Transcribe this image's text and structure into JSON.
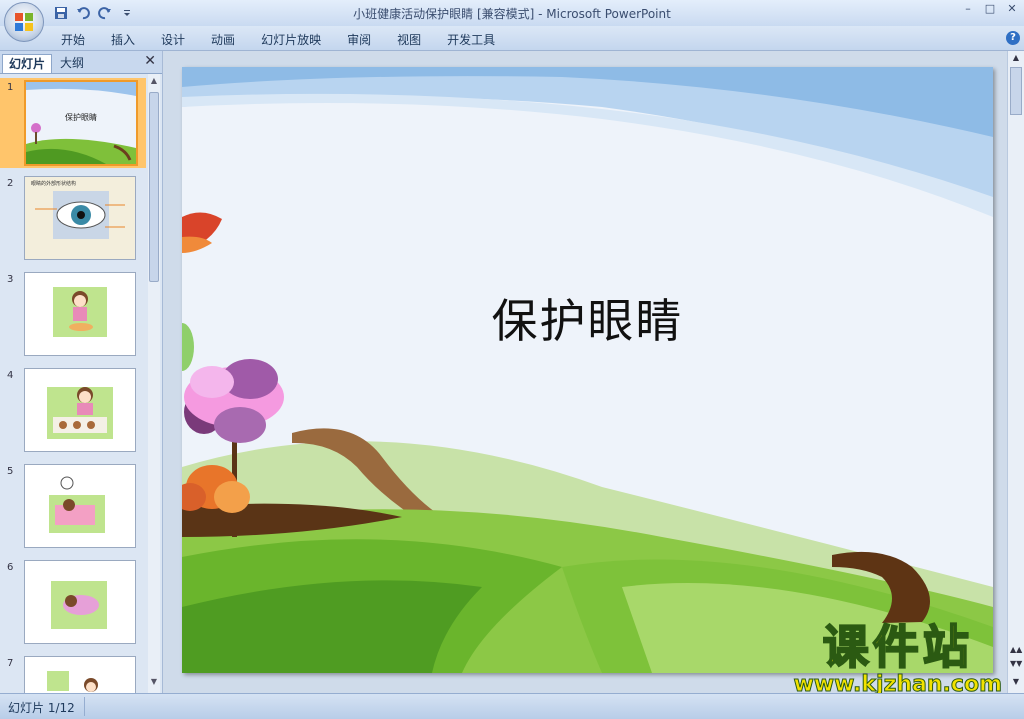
{
  "window": {
    "title": "小班健康活动保护眼睛 [兼容模式] - Microsoft PowerPoint",
    "controls": [
      "–",
      "□",
      "✕"
    ]
  },
  "qat": {
    "icons": [
      "save-icon",
      "undo-icon",
      "redo-icon",
      "customize-icon"
    ]
  },
  "menu": {
    "items": [
      "开始",
      "插入",
      "设计",
      "动画",
      "幻灯片放映",
      "审阅",
      "视图",
      "开发工具"
    ]
  },
  "panel": {
    "tabs": {
      "slides": "幻灯片",
      "outline": "大纲"
    },
    "thumbnails": [
      {
        "num": "1",
        "caption": "保护眼睛"
      },
      {
        "num": "2",
        "caption": "眼睛的外部形状结构"
      },
      {
        "num": "3",
        "caption": ""
      },
      {
        "num": "4",
        "caption": ""
      },
      {
        "num": "5",
        "caption": ""
      },
      {
        "num": "6",
        "caption": ""
      },
      {
        "num": "7",
        "caption": ""
      }
    ]
  },
  "slide": {
    "title": "保护眼睛"
  },
  "watermark": {
    "cn": "课件站",
    "url": "www.kjzhan.com"
  },
  "status": {
    "slide_count": "幻灯片 1/12"
  },
  "colors": {
    "selected_thumb": "#ffc56b",
    "ribbon": "#c4d6ee",
    "grass": "#6cb52c"
  }
}
